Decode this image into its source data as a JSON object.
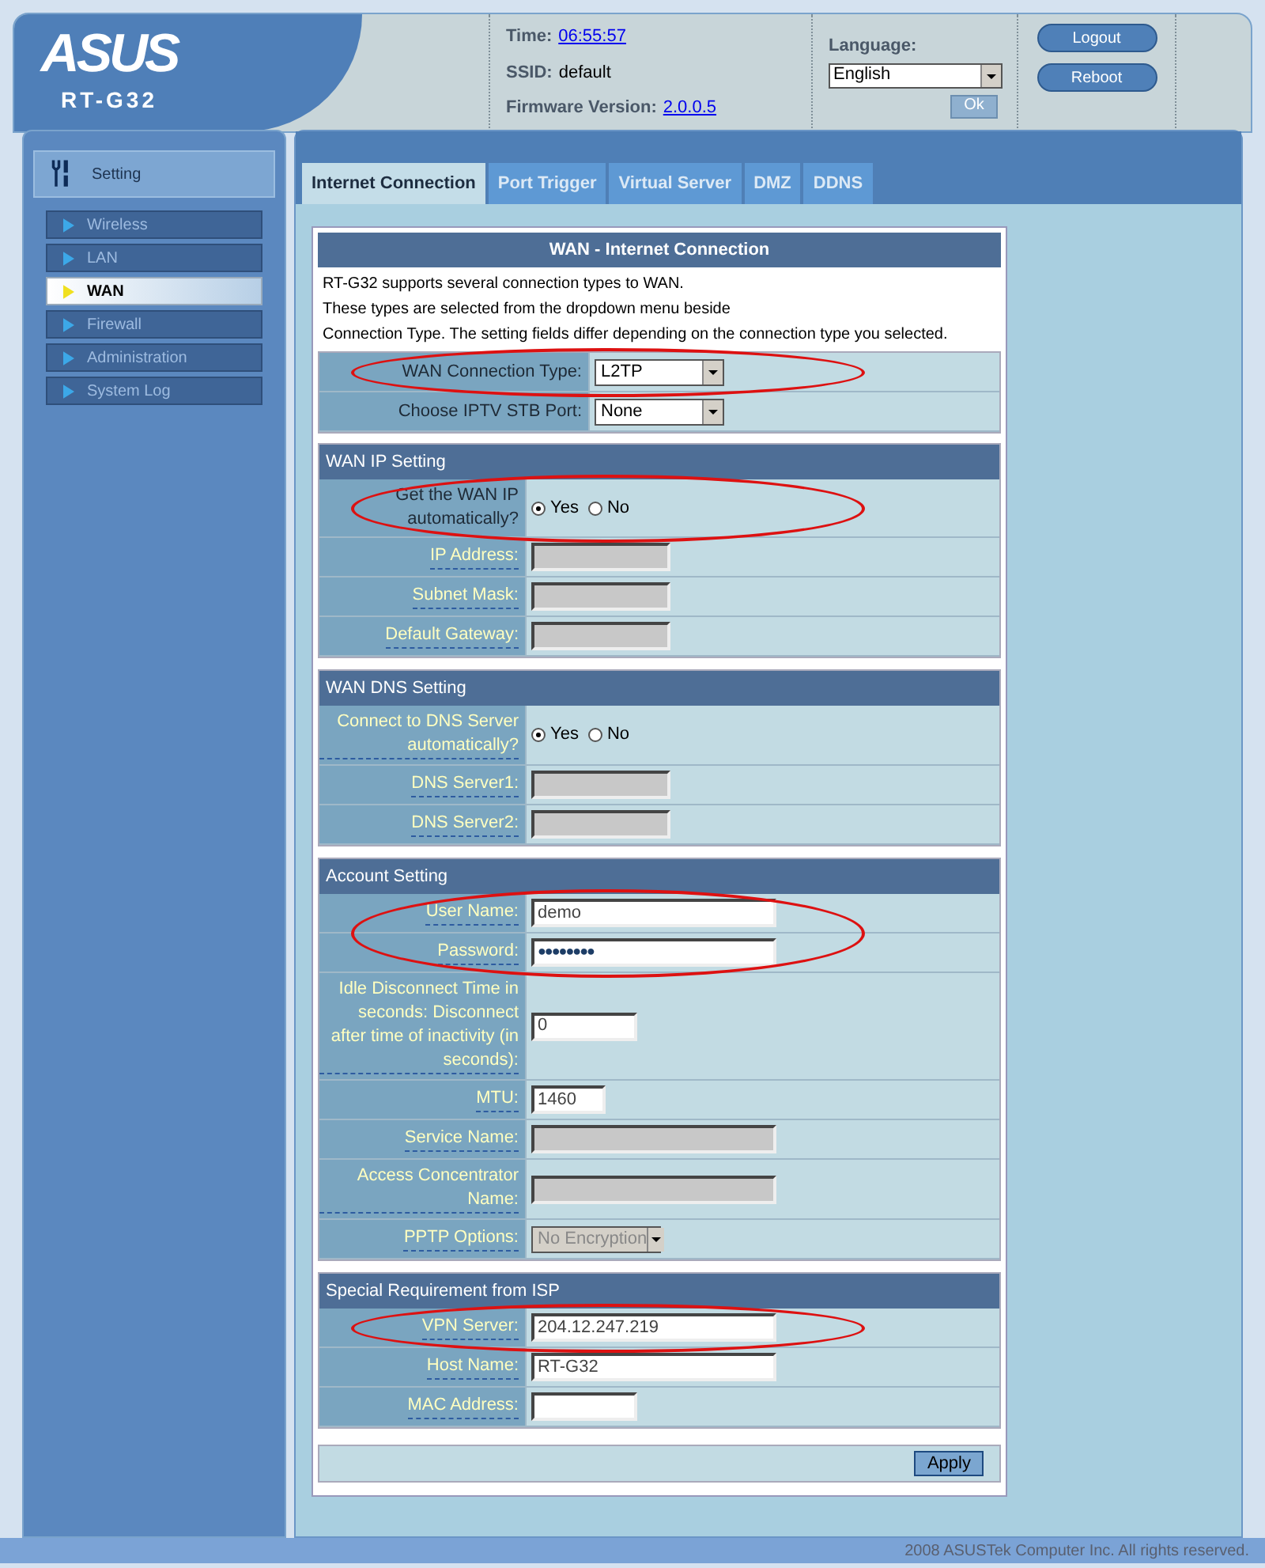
{
  "header": {
    "brand": "ASUS",
    "model": "RT-G32",
    "time_label": "Time:",
    "time": "06:55:57",
    "ssid_label": "SSID:",
    "ssid": "default",
    "firmware_label": "Firmware Version:",
    "firmware": "2.0.0.5",
    "language_label": "Language:",
    "language": "English",
    "ok_button": "Ok",
    "buttons": [
      "Logout",
      "Reboot"
    ]
  },
  "sidebar": {
    "title": "Setting",
    "items": [
      {
        "label": "Wireless",
        "selected": false
      },
      {
        "label": "LAN",
        "selected": false
      },
      {
        "label": "WAN",
        "selected": true
      },
      {
        "label": "Firewall",
        "selected": false
      },
      {
        "label": "Administration",
        "selected": false
      },
      {
        "label": "System Log",
        "selected": false
      }
    ]
  },
  "tabs": [
    {
      "label": "Internet Connection",
      "selected": true
    },
    {
      "label": "Port Trigger",
      "selected": false
    },
    {
      "label": "Virtual Server",
      "selected": false
    },
    {
      "label": "DMZ",
      "selected": false
    },
    {
      "label": "DDNS",
      "selected": false
    }
  ],
  "form": {
    "title": "WAN - Internet Connection",
    "description": [
      "RT-G32 supports several connection types to WAN.",
      "These types are selected from the dropdown menu beside",
      "Connection Type. The setting fields differ depending on the connection type you selected."
    ],
    "top_rows": [
      {
        "label": "WAN Connection Type:",
        "kind": "select",
        "value": "L2TP",
        "help_link": false,
        "circled": true,
        "disabled": false
      },
      {
        "label": "Choose IPTV STB Port:",
        "kind": "select",
        "value": "None",
        "help_link": false,
        "circled": false,
        "disabled": false
      }
    ],
    "sections": [
      {
        "title": "WAN IP Setting",
        "rows": [
          {
            "label": "Get the WAN IP automatically?",
            "kind": "radio",
            "help_link": false,
            "circled": true,
            "options": [
              {
                "label": "Yes",
                "selected": true
              },
              {
                "label": "No",
                "selected": false
              }
            ]
          },
          {
            "label": "IP Address:",
            "kind": "short",
            "value": "",
            "help_link": true,
            "circled": false,
            "disabled": true
          },
          {
            "label": "Subnet Mask:",
            "kind": "short",
            "value": "",
            "help_link": true,
            "circled": false,
            "disabled": true
          },
          {
            "label": "Default Gateway:",
            "kind": "short",
            "value": "",
            "help_link": true,
            "circled": false,
            "disabled": true
          }
        ]
      },
      {
        "title": "WAN DNS Setting",
        "rows": [
          {
            "label": "Connect to DNS Server automatically?",
            "kind": "radio",
            "help_link": true,
            "circled": false,
            "options": [
              {
                "label": "Yes",
                "selected": true
              },
              {
                "label": "No",
                "selected": false
              }
            ]
          },
          {
            "label": "DNS Server1:",
            "kind": "short",
            "value": "",
            "help_link": true,
            "circled": false,
            "disabled": true
          },
          {
            "label": "DNS Server2:",
            "kind": "short",
            "value": "",
            "help_link": true,
            "circled": false,
            "disabled": true
          }
        ]
      },
      {
        "title": "Account Setting",
        "rows": [
          {
            "label": "User Name:",
            "kind": "text",
            "value": "demo",
            "help_link": true,
            "circled": true,
            "disabled": false
          },
          {
            "label": "Password:",
            "kind": "password",
            "value": "●●●●●●●●",
            "help_link": true,
            "circled": true,
            "disabled": false
          },
          {
            "label": "Idle Disconnect Time in seconds: Disconnect after time of inactivity (in seconds):",
            "kind": "number",
            "value": "0",
            "help_link": true,
            "circled": false,
            "disabled": false
          },
          {
            "label": "MTU:",
            "kind": "small",
            "value": "1460",
            "help_link": true,
            "circled": false,
            "disabled": false
          },
          {
            "label": "Service Name:",
            "kind": "text",
            "value": "",
            "help_link": true,
            "circled": false,
            "disabled": true
          },
          {
            "label": "Access Concentrator Name:",
            "kind": "text",
            "value": "",
            "help_link": true,
            "circled": false,
            "disabled": true
          },
          {
            "label": "PPTP Options:",
            "kind": "select",
            "value": "No Encryption",
            "help_link": true,
            "circled": false,
            "disabled": true
          }
        ]
      },
      {
        "title": "Special Requirement from ISP",
        "rows": [
          {
            "label": "VPN Server:",
            "kind": "text",
            "value": "204.12.247.219",
            "help_link": true,
            "circled": true,
            "disabled": false
          },
          {
            "label": "Host Name:",
            "kind": "text",
            "value": "RT-G32",
            "help_link": true,
            "circled": false,
            "disabled": false
          },
          {
            "label": "MAC Address:",
            "kind": "number",
            "value": "",
            "help_link": true,
            "circled": false,
            "disabled": false
          }
        ]
      }
    ],
    "apply_button": "Apply"
  },
  "footer": "2008 ASUSTek Computer Inc. All rights reserved."
}
